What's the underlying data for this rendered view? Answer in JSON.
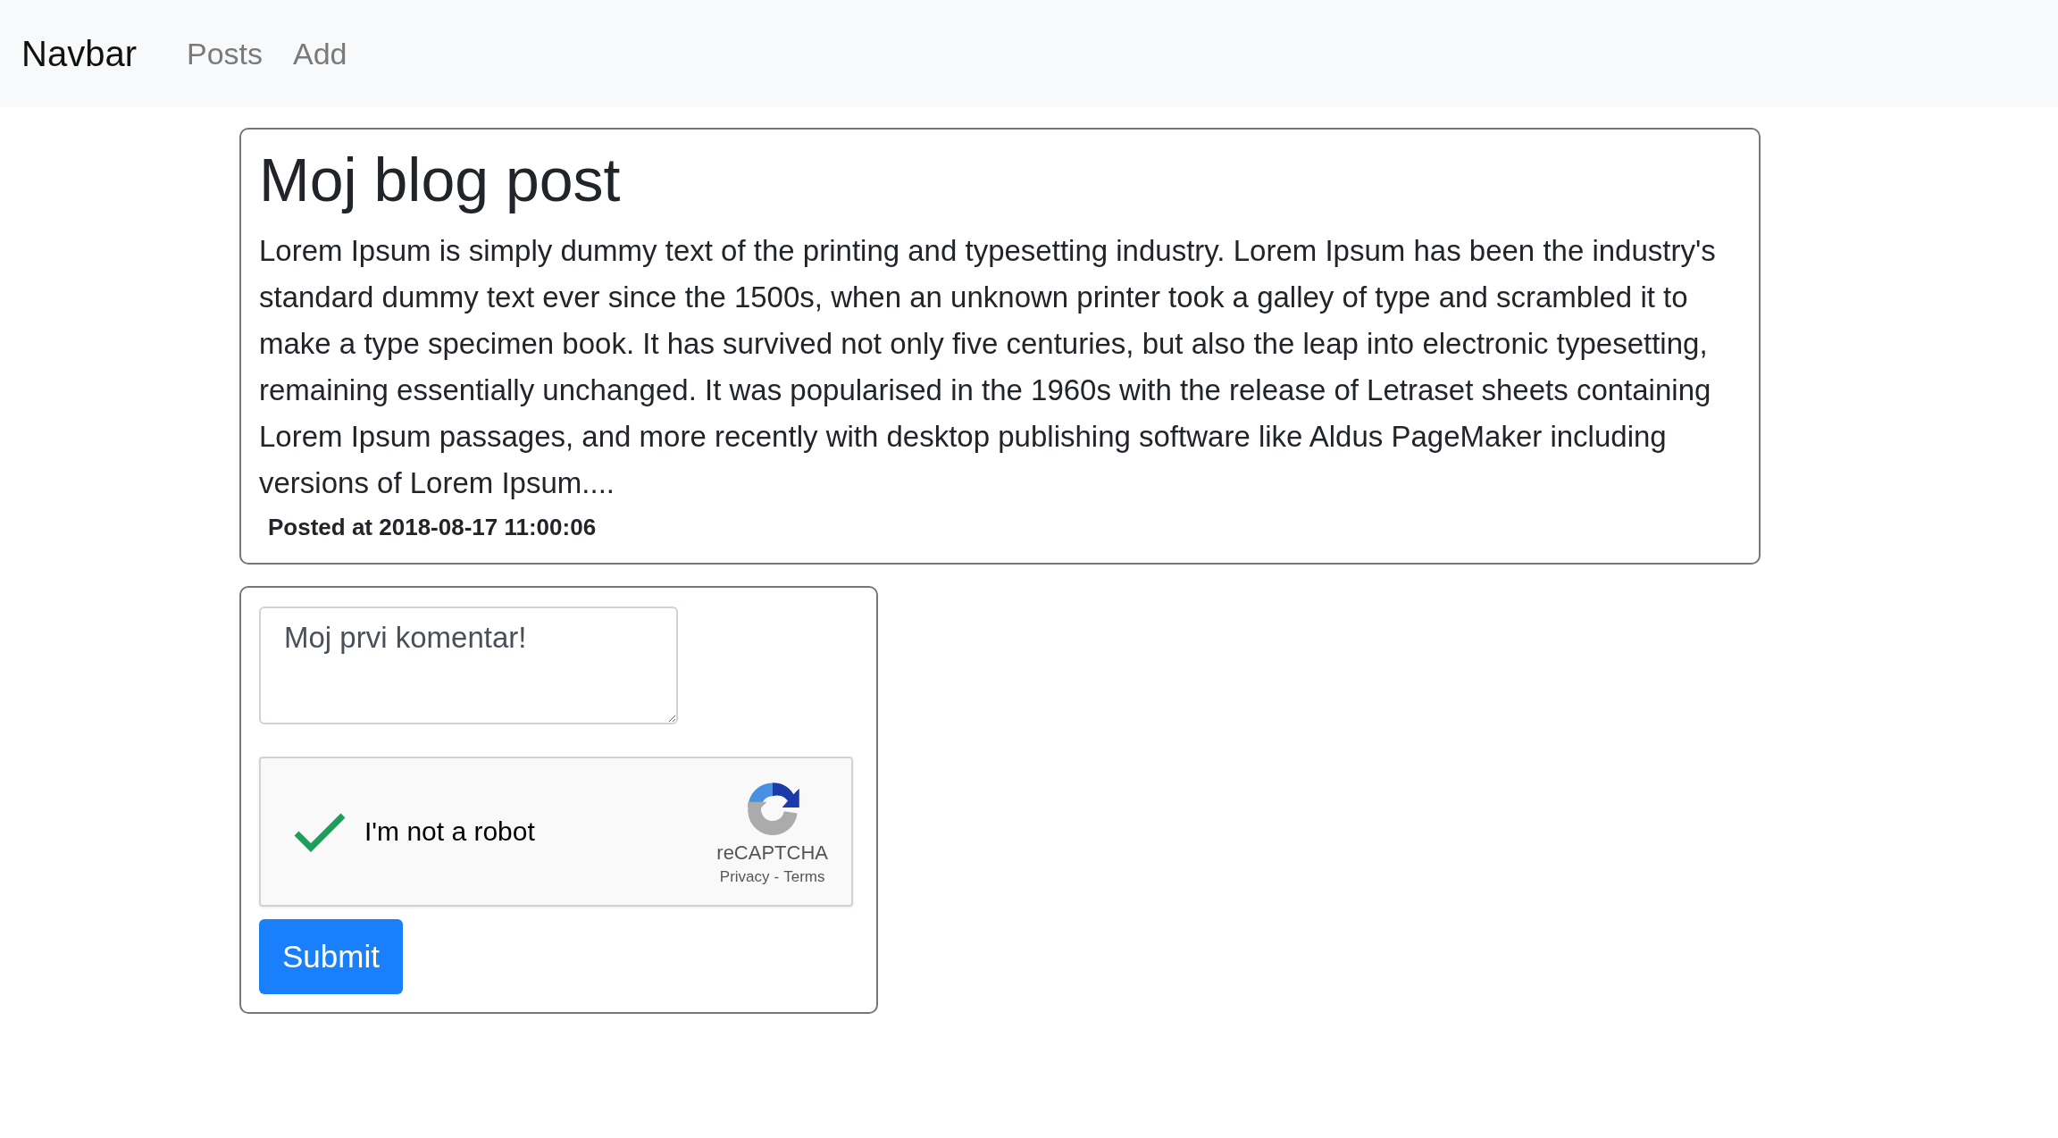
{
  "navbar": {
    "brand": "Navbar",
    "links": [
      {
        "label": "Posts"
      },
      {
        "label": "Add"
      }
    ]
  },
  "post": {
    "title": "Moj blog post",
    "body": "Lorem Ipsum is simply dummy text of the printing and typesetting industry. Lorem Ipsum has been the industry's standard dummy text ever since the 1500s, when an unknown printer took a galley of type and scrambled it to make a type specimen book. It has survived not only five centuries, but also the leap into electronic typesetting, remaining essentially unchanged. It was popularised in the 1960s with the release of Letraset sheets containing Lorem Ipsum passages, and more recently with desktop publishing software like Aldus PageMaker including versions of Lorem Ipsum....",
    "posted": "Posted at 2018-08-17 11:00:06"
  },
  "comment_form": {
    "comment": {
      "value": "Moj prvi komentar!"
    },
    "captcha": {
      "label": "I'm not a robot",
      "checked": true,
      "brand": "reCAPTCHA",
      "privacy": "Privacy",
      "separator": "-",
      "terms": "Terms"
    },
    "submit": "Submit"
  }
}
